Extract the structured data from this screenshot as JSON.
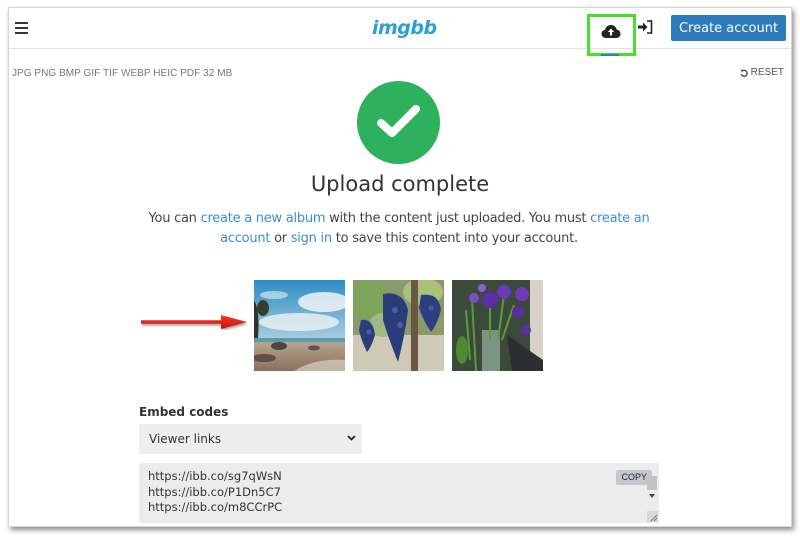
{
  "header": {
    "logo": "imgbb",
    "menu_icon": "hamburger-menu-icon",
    "upload_icon": "cloud-upload-icon",
    "signin_icon": "sign-in-icon",
    "create_account_label": "Create account",
    "accent_color": "#2d7bbd",
    "highlight_color": "#44e02a"
  },
  "toolbar": {
    "formats": "JPG PNG BMP GIF TIF WEBP HEIC PDF  32 MB",
    "reset_label": "RESET",
    "reset_icon": "undo-icon"
  },
  "status": {
    "icon": "check-circle-icon",
    "color": "#2eb15d",
    "title": "Upload complete",
    "desc_prefix": "You can ",
    "link_album": "create a new album",
    "desc_mid": " with the content just uploaded. You must ",
    "link_create_account": "create an account",
    "desc_or": " or ",
    "link_sign_in": "sign in",
    "desc_suffix": " to save this content into your account."
  },
  "annotation": {
    "arrow_icon": "red-arrow-icon",
    "arrow_color": "#e0201c"
  },
  "thumbnails": [
    {
      "subject": "beach with rocks and cloudy sky"
    },
    {
      "subject": "bunches of purple grapes on vine"
    },
    {
      "subject": "purple flowers in glass vase"
    }
  ],
  "embed": {
    "label": "Embed codes",
    "selected_option": "Viewer links",
    "links": [
      "https://ibb.co/sg7qWsN",
      "https://ibb.co/P1Dn5C7",
      "https://ibb.co/m8CCrPC"
    ],
    "copy_label": "COPY"
  }
}
